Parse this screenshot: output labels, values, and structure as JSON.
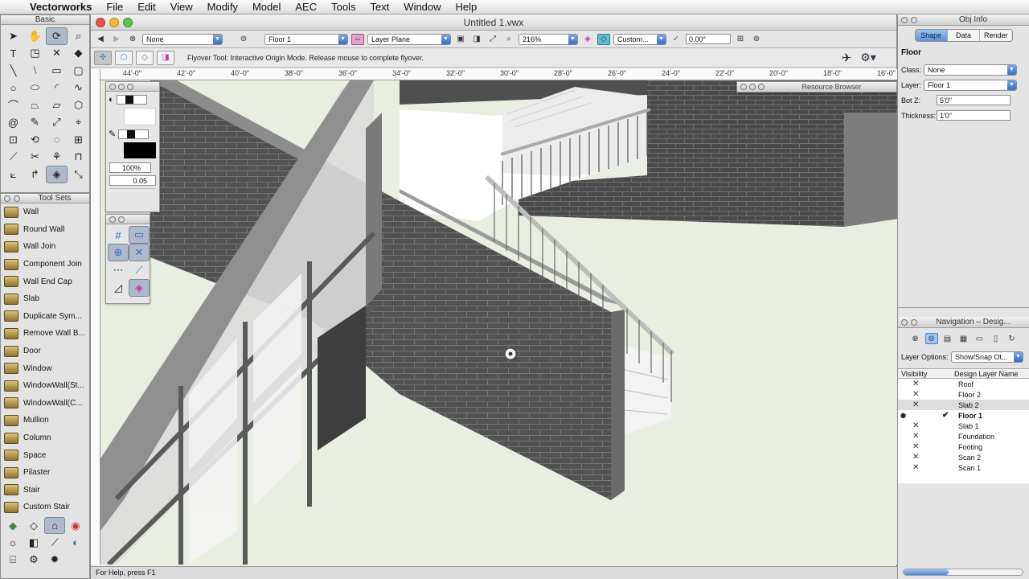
{
  "menubar": {
    "app": "Vectorworks",
    "items": [
      "File",
      "Edit",
      "View",
      "Modify",
      "Model",
      "AEC",
      "Tools",
      "Text",
      "Window",
      "Help"
    ]
  },
  "basic_palette": {
    "title": "Basic"
  },
  "toolsets": {
    "title": "Tool Sets",
    "items": [
      "Wall",
      "Round Wall",
      "Wall Join",
      "Component Join",
      "Wall End Cap",
      "Slab",
      "Duplicate Sym...",
      "Remove Wall B...",
      "Door",
      "Window",
      "WindowWall(St...",
      "WindowWall(C...",
      "Mullion",
      "Column",
      "Space",
      "Pilaster",
      "Stair",
      "Custom Stair"
    ]
  },
  "document": {
    "title": "Untitled 1.vwx",
    "class_select": "None",
    "layer_select": "Floor 1",
    "plane_select": "Layer Plane",
    "zoom": "216%",
    "view_select": "Custom...",
    "angle": "0.00°",
    "mode_hint": "Flyover Tool: Interactive Origin Mode. Release mouse to complete flyover.",
    "status": "For Help, press F1",
    "ruler_labels": [
      "44'-0\"",
      "42'-0\"",
      "40'-0\"",
      "38'-0\"",
      "36'-0\"",
      "34'-0\"",
      "32'-0\"",
      "30'-0\"",
      "28'-0\"",
      "26'-0\"",
      "24'-0\"",
      "22'-0\"",
      "20'-0\"",
      "18'-0\"",
      "16'-0\""
    ]
  },
  "attributes_palette": {
    "opacity": "100%",
    "line_weight": "0.05"
  },
  "resource_browser": {
    "title": "Resource Browser"
  },
  "obj_info": {
    "title": "Obj Info",
    "tabs": [
      "Shape",
      "Data",
      "Render"
    ],
    "object_type": "Floor",
    "class_label": "Class:",
    "class_value": "None",
    "layer_label": "Layer:",
    "layer_value": "Floor 1",
    "botz_label": "Bot Z:",
    "botz_value": "5'0\"",
    "thickness_label": "Thickness:",
    "thickness_value": "1'0\""
  },
  "navigation": {
    "title": "Navigation – Desig...",
    "layer_options_label": "Layer Options:",
    "layer_options_value": "Show/Snap Ot...",
    "col_visibility": "Visibility",
    "col_name": "Design Layer Name",
    "layers": [
      "Roof",
      "Floor 2",
      "Slab 2",
      "Floor 1",
      "Slab 1",
      "Foundation",
      "Footing",
      "Scan 2",
      "Scan 1"
    ]
  },
  "colors": {
    "canvas": "#e8efe2",
    "wall": "#4e4e4e",
    "accent": "#5b93d8"
  }
}
